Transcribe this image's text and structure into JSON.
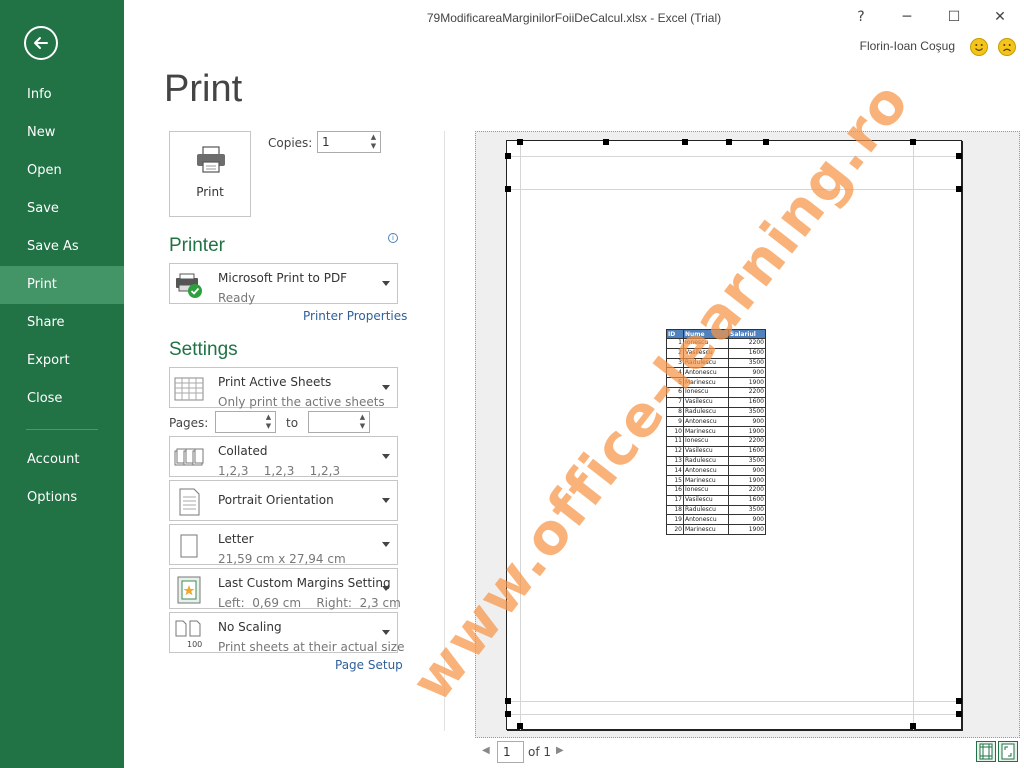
{
  "window": {
    "title": "79ModificareaMarginilorFoiiDeCalcul.xlsx - Excel (Trial)",
    "help": "?",
    "minimize": "─",
    "maximize": "☐",
    "close": "✕",
    "user": "Florin-Ioan Coşug"
  },
  "sidebar": {
    "items": [
      {
        "label": "Info"
      },
      {
        "label": "New"
      },
      {
        "label": "Open"
      },
      {
        "label": "Save"
      },
      {
        "label": "Save As"
      },
      {
        "label": "Print",
        "active": true
      },
      {
        "label": "Share"
      },
      {
        "label": "Export"
      },
      {
        "label": "Close"
      }
    ],
    "bottom_items": [
      {
        "label": "Account"
      },
      {
        "label": "Options"
      }
    ]
  },
  "page_title": "Print",
  "print": {
    "button_label": "Print",
    "copies_label": "Copies:",
    "copies_value": "1"
  },
  "printer": {
    "heading": "Printer",
    "name": "Microsoft Print to PDF",
    "status": "Ready",
    "properties_link": "Printer Properties"
  },
  "settings": {
    "heading": "Settings",
    "what": {
      "title": "Print Active Sheets",
      "subtitle": "Only print the active sheets"
    },
    "pages_label": "Pages:",
    "to_label": "to",
    "collate": {
      "title": "Collated",
      "subtitle": "1,2,3    1,2,3    1,2,3"
    },
    "orientation": {
      "title": "Portrait Orientation"
    },
    "paper": {
      "title": "Letter",
      "subtitle": "21,59 cm x 27,94 cm"
    },
    "margins": {
      "title": "Last Custom Margins Setting",
      "subtitle": "Left:  0,69 cm    Right:  2,3 cm"
    },
    "scaling": {
      "title": "No Scaling",
      "subtitle": "Print sheets at their actual size"
    },
    "page_setup_link": "Page Setup",
    "scaling_icon_text": "100"
  },
  "preview": {
    "table": {
      "headers": [
        "ID",
        "Nume",
        "Salariul"
      ],
      "rows": [
        [
          "1",
          "Ionescu",
          "2200"
        ],
        [
          "2",
          "Vasilescu",
          "1600"
        ],
        [
          "3",
          "Radulescu",
          "3500"
        ],
        [
          "4",
          "Antonescu",
          "900"
        ],
        [
          "5",
          "Marinescu",
          "1900"
        ],
        [
          "6",
          "Ionescu",
          "2200"
        ],
        [
          "7",
          "Vasilescu",
          "1600"
        ],
        [
          "8",
          "Radulescu",
          "3500"
        ],
        [
          "9",
          "Antonescu",
          "900"
        ],
        [
          "10",
          "Marinescu",
          "1900"
        ],
        [
          "11",
          "Ionescu",
          "2200"
        ],
        [
          "12",
          "Vasilescu",
          "1600"
        ],
        [
          "13",
          "Radulescu",
          "3500"
        ],
        [
          "14",
          "Antonescu",
          "900"
        ],
        [
          "15",
          "Marinescu",
          "1900"
        ],
        [
          "16",
          "Ionescu",
          "2200"
        ],
        [
          "17",
          "Vasilescu",
          "1600"
        ],
        [
          "18",
          "Radulescu",
          "3500"
        ],
        [
          "19",
          "Antonescu",
          "900"
        ],
        [
          "20",
          "Marinescu",
          "1900"
        ]
      ]
    },
    "watermark": "www.office-learning.ro"
  },
  "pager": {
    "current": "1",
    "of_label": "of 1",
    "prev": "◀",
    "next": "▶"
  },
  "colors": {
    "accent": "#217346",
    "active_nav": "#439467",
    "link": "#2e5f99",
    "table_header": "#4f81bd",
    "watermark": "#f79646"
  },
  "icons": {
    "back": "back-arrow-icon",
    "printer": "printer-icon",
    "smile": "smile-icon",
    "frown": "frown-icon",
    "info": "info-icon"
  }
}
